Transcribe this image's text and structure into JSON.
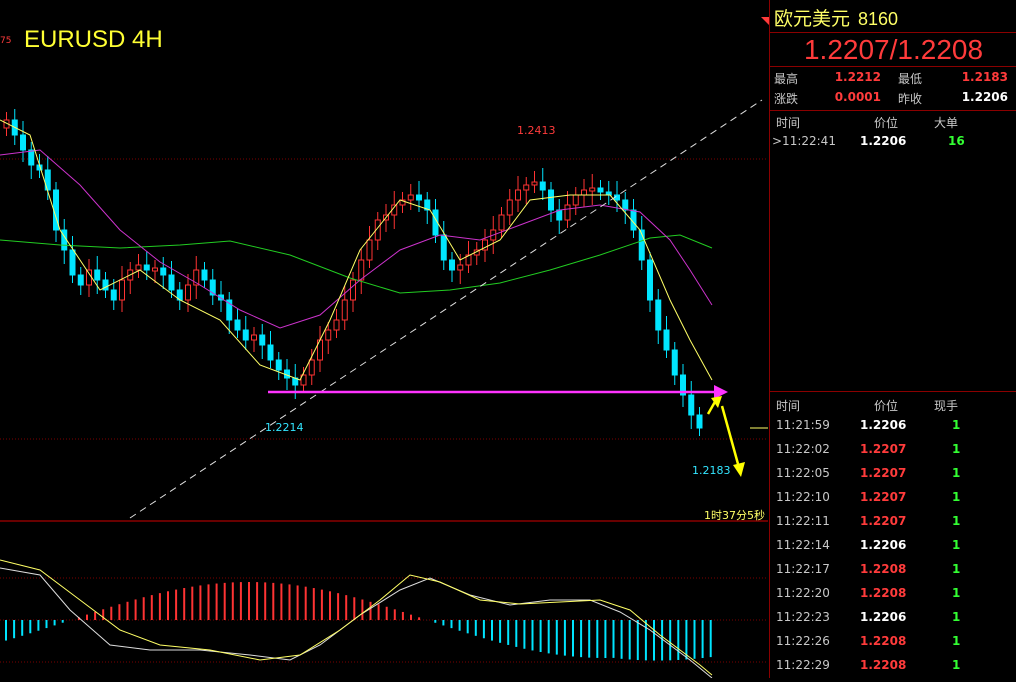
{
  "chart": {
    "title": "EURUSD 4H",
    "edge_label": "75",
    "countdown": "1时37分5秒",
    "annotations": {
      "high": "1.2413",
      "low_left": "1.2214",
      "low_right": "1.2183"
    },
    "colors": {
      "up": "#ff3333",
      "down": "#00e5ff",
      "ma_yellow": "#ffff66",
      "ma_magenta": "#cc33cc",
      "ma_green": "#22cc22",
      "arrow_magenta": "#ff33ff",
      "arrow_yellow": "#ffff00"
    }
  },
  "quote": {
    "name": "欧元美元",
    "code": "8160",
    "price": "1.2207/1.2208",
    "stats": [
      {
        "label": "最高",
        "value": "1.2212",
        "color": "#ff3b3b"
      },
      {
        "label": "最低",
        "value": "1.2183",
        "color": "#ff3b3b"
      },
      {
        "label": "涨跌",
        "value": "0.0001",
        "color": "#ff3b3b"
      },
      {
        "label": "昨收",
        "value": "1.2206",
        "color": "#ffffff"
      }
    ]
  },
  "big_orders": {
    "headers": [
      "时间",
      "价位",
      "大单"
    ],
    "rows": [
      {
        "time": ">11:22:41",
        "price": "1.2206",
        "vol": "16",
        "price_color": "#ffffff"
      }
    ]
  },
  "ticks": {
    "headers": [
      "时间",
      "价位",
      "现手"
    ],
    "rows": [
      {
        "time": "11:21:59",
        "price": "1.2206",
        "vol": "1",
        "price_color": "#ffffff"
      },
      {
        "time": "11:22:02",
        "price": "1.2207",
        "vol": "1",
        "price_color": "#ff3b3b"
      },
      {
        "time": "11:22:05",
        "price": "1.2207",
        "vol": "1",
        "price_color": "#ff3b3b"
      },
      {
        "time": "11:22:10",
        "price": "1.2207",
        "vol": "1",
        "price_color": "#ff3b3b"
      },
      {
        "time": "11:22:11",
        "price": "1.2207",
        "vol": "1",
        "price_color": "#ff3b3b"
      },
      {
        "time": "11:22:14",
        "price": "1.2206",
        "vol": "1",
        "price_color": "#ffffff"
      },
      {
        "time": "11:22:17",
        "price": "1.2208",
        "vol": "1",
        "price_color": "#ff3b3b"
      },
      {
        "time": "11:22:20",
        "price": "1.2208",
        "vol": "1",
        "price_color": "#ff3b3b"
      },
      {
        "time": "11:22:23",
        "price": "1.2206",
        "vol": "1",
        "price_color": "#ffffff"
      },
      {
        "time": "11:22:26",
        "price": "1.2208",
        "vol": "1",
        "price_color": "#ff3b3b"
      },
      {
        "time": "11:22:29",
        "price": "1.2208",
        "vol": "1",
        "price_color": "#ff3b3b"
      }
    ]
  }
}
